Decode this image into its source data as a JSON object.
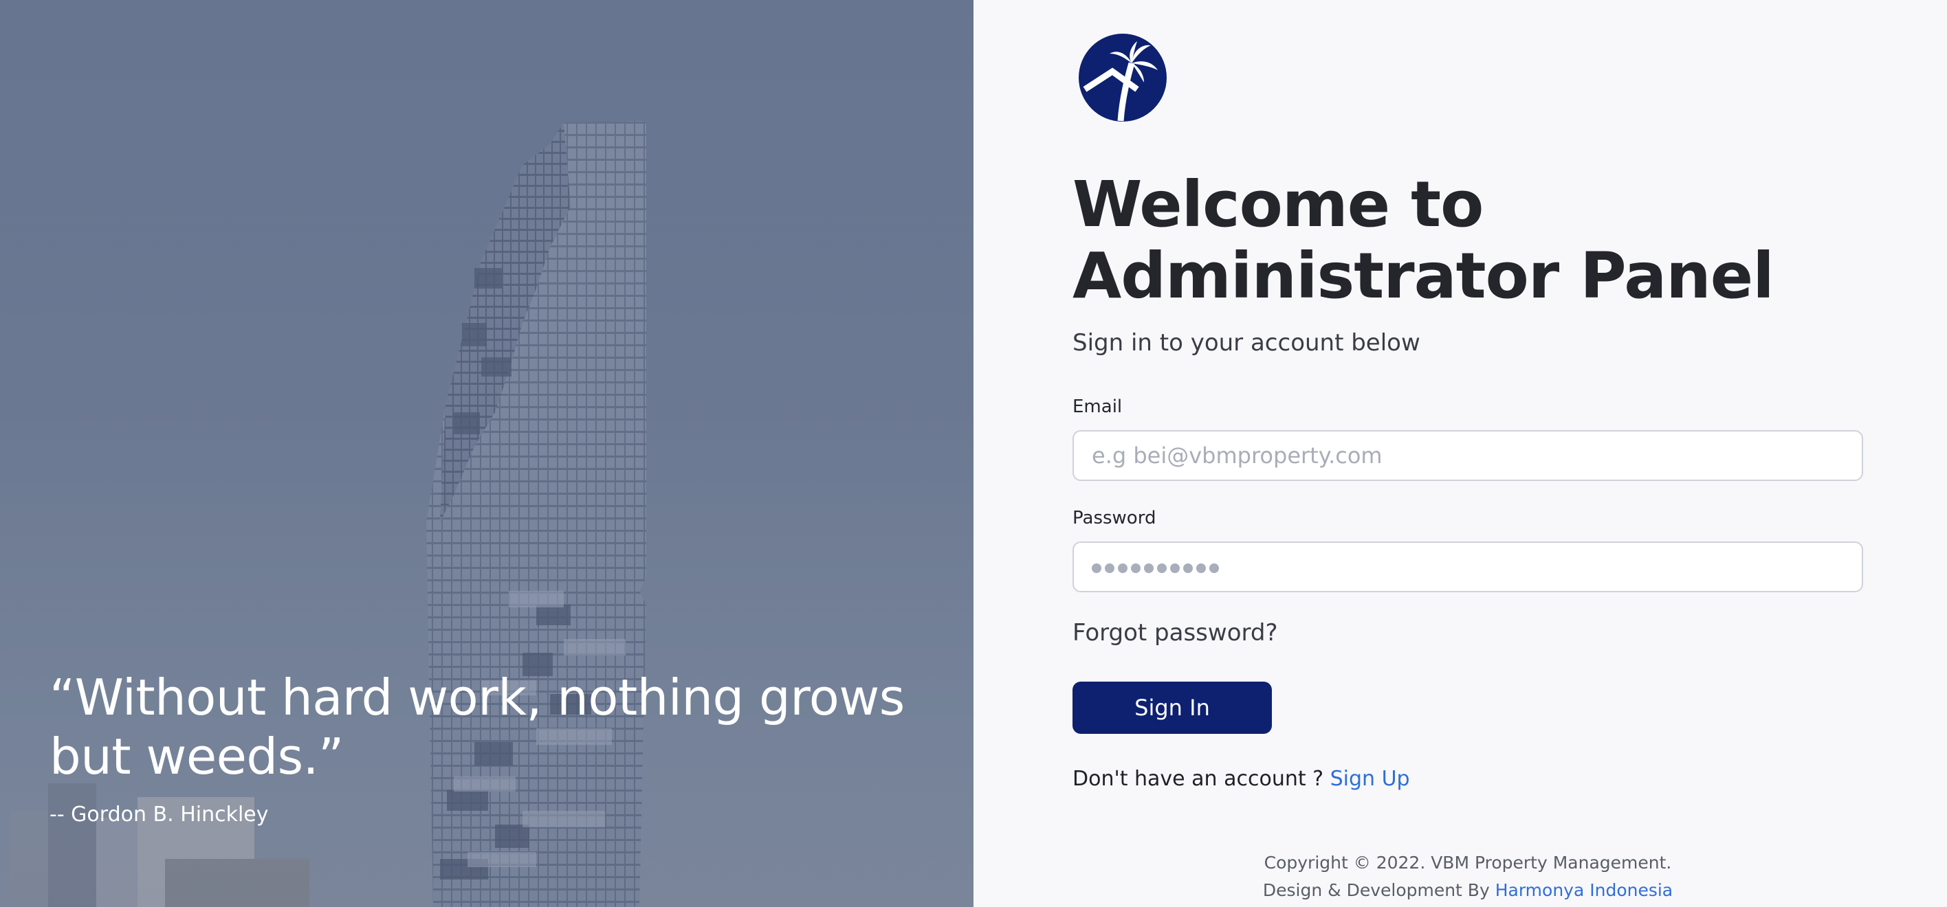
{
  "hero": {
    "quote": "“Without hard work, nothing grows but weeds.”",
    "author": "-- Gordon B. Hinckley"
  },
  "brand": {
    "logo_icon": "palm-house-icon",
    "primary_color": "#0d2170",
    "link_color": "#2f6fd6"
  },
  "form": {
    "title": "Welcome to Administrator Panel",
    "subtitle": "Sign in to your account below",
    "email_label": "Email",
    "email_placeholder": "e.g bei@vbmproperty.com",
    "email_value": "",
    "password_label": "Password",
    "password_value": "●●●●●●●●●●",
    "forgot_label": "Forgot password?",
    "signin_label": "Sign In",
    "no_account_text": "Don't have an account ?",
    "signup_label": "Sign Up"
  },
  "footer": {
    "copyright": "Copyright © 2022. VBM Property Management.",
    "design_prefix": "Design & Development By",
    "design_link": "Harmonya Indonesia"
  }
}
